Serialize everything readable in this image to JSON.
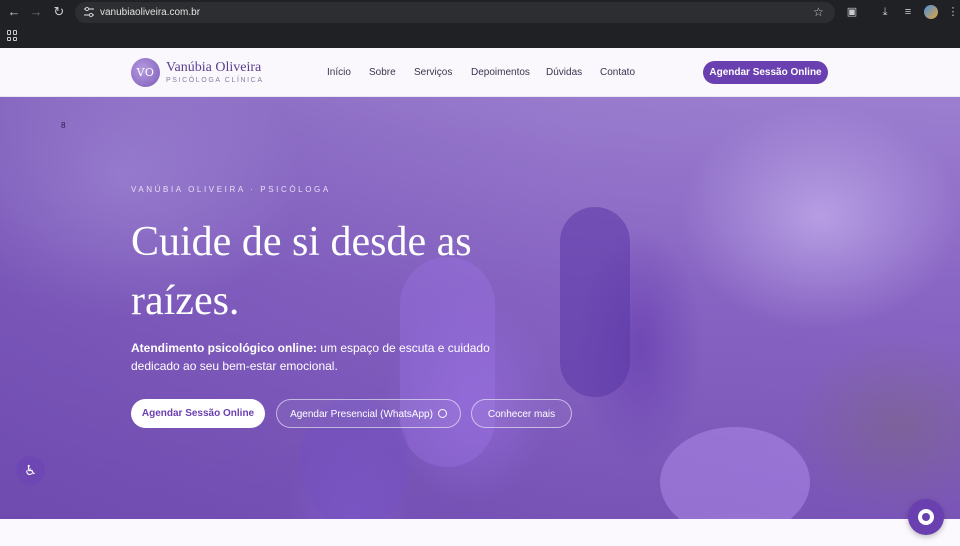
{
  "browser": {
    "url": "vanubiaoliveira.com.br",
    "icons": [
      "back-icon",
      "forward-icon",
      "reload-icon",
      "site-info-icon",
      "bookmark-star-icon",
      "extensions-icon",
      "download-icon",
      "media-icon",
      "profile-icon",
      "menu-dots-icon",
      "apps-icon"
    ]
  },
  "header": {
    "logo_initials": "VO",
    "logo_name": "Vanúbia Oliveira",
    "logo_subtitle": "PSICÓLOGA CLÍNICA",
    "nav": [
      "Início",
      "Sobre",
      "Serviços",
      "Depoimentos",
      "Dúvidas",
      "Contato"
    ],
    "cta": "Agendar Sessão Online"
  },
  "hero": {
    "eyebrow": "VANÚBIA OLIVEIRA · PSICÓLOGA",
    "headline_line1": "Cuide de si desde as",
    "headline_line2": "raízes.",
    "lead_bold": "Atendimento psicológico online:",
    "lead_rest": " um espaço de escuta e cuidado dedicado ao seu bem-estar emocional.",
    "btn_primary": "Agendar Sessão Online",
    "btn_whatsapp": "Agendar Presencial (WhatsApp)",
    "btn_more": "Conhecer mais",
    "mark": "8"
  },
  "colors": {
    "brand": "#6a3fb0",
    "header_bg": "#faf8fc",
    "chrome_bg": "#202124"
  }
}
